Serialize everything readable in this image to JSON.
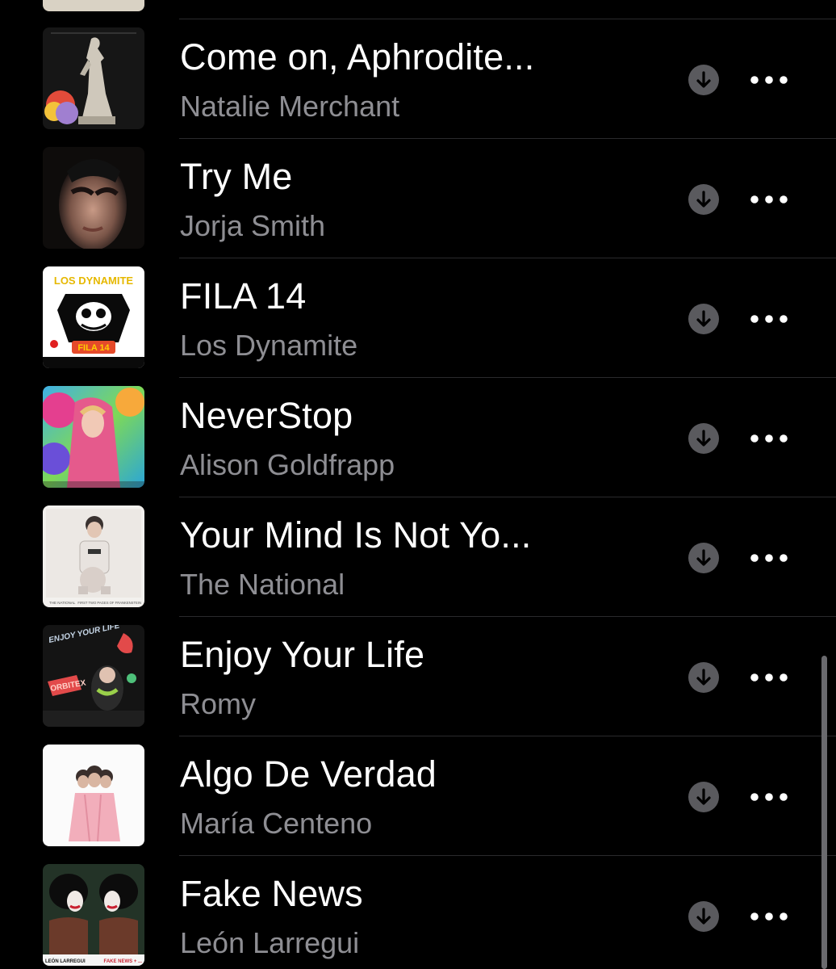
{
  "songs": [
    {
      "title": "Come on, Aphrodite...",
      "artist": "Natalie Merchant",
      "artwork": "statue-artwork"
    },
    {
      "title": "Try Me",
      "artist": "Jorja Smith",
      "artwork": "portrait-artwork"
    },
    {
      "title": "FILA 14",
      "artist": "Los Dynamite",
      "artwork": "cartoon-artwork"
    },
    {
      "title": "NeverStop",
      "artist": "Alison Goldfrapp",
      "artwork": "colorful-portrait-artwork"
    },
    {
      "title": "Your Mind Is Not Yo...",
      "artist": "The National",
      "artwork": "child-photo-artwork"
    },
    {
      "title": "Enjoy Your Life",
      "artist": "Romy",
      "artwork": "neon-artwork"
    },
    {
      "title": "Algo De Verdad",
      "artist": "María Centeno",
      "artwork": "figures-artwork"
    },
    {
      "title": "Fake News",
      "artist": "León Larregui",
      "artwork": "masks-artwork"
    }
  ],
  "artwork_text": {
    "los_dynamite_logo": "LOS DYNAMITE",
    "los_dynamite_badge": "FILA 14",
    "romy_cover": "ENJOY YOUR LIFE",
    "national_left": "THE NATIONAL",
    "national_right": "FIRST TWO PAGES OF FRANKENSTEIN",
    "leon_left": "LEÓN LARREGUI",
    "leon_right": "FAKE NEWS + ..."
  },
  "colors": {
    "background": "#000000",
    "title": "#ffffff",
    "subtitle": "#8e8e93",
    "download_button": "#5a5a5e",
    "separator": "#2a2a2c"
  },
  "icons": {
    "download": "download-icon",
    "more": "more-options-icon"
  }
}
